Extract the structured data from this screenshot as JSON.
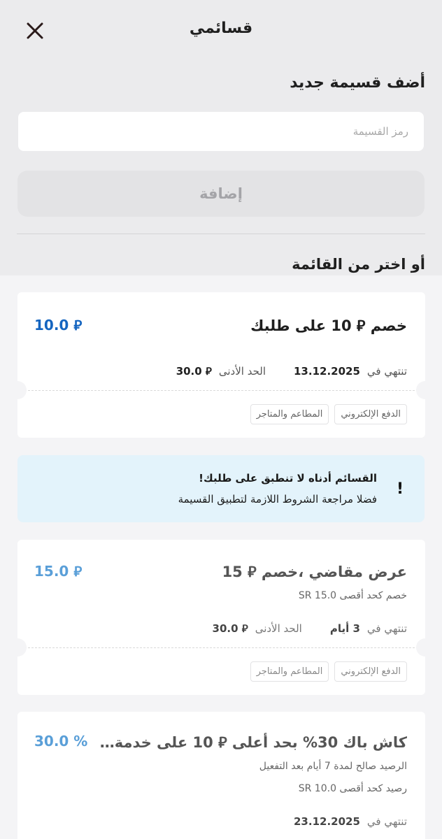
{
  "header": {
    "title": "قسائمي"
  },
  "add_section": {
    "heading": "أضف قسيمة جديد",
    "input_placeholder": "رمز القسيمة",
    "input_value": "",
    "button_label": "إضافة"
  },
  "list_heading": "أو اختر من القائمة",
  "colors": {
    "accent_blue": "#1565c0",
    "muted_blue": "#5a9fd8",
    "notice_bg": "#e3f3fb"
  },
  "coupons": [
    {
      "title": "خصم ⃁ 10 على طلبك",
      "value": "⃁ 10.0",
      "expires_label": "تنتهي في",
      "expires_value": "13.12.2025",
      "min_label": "الحد الأدنى",
      "min_value": "⃁ 30.0",
      "tags": [
        "الدفع الإلكتروني",
        "المطاعم والمتاجر"
      ]
    },
    {
      "title": "عرض مقاضي ،خصم ⃁ 15",
      "value": "⃁ 15.0",
      "subtitle": "خصم كحد أقصى SR 15.0",
      "expires_label": "تنتهي في",
      "expires_value": "3 أيام",
      "min_label": "الحد الأدنى",
      "min_value": "⃁ 30.0",
      "tags": [
        "الدفع الإلكتروني",
        "المطاعم والمتاجر"
      ]
    },
    {
      "title": "كاش باك 30% بحد أعلى ⃁ 10 على خدمة ا...",
      "value": "30.0 %",
      "subtitle_1": "الرصيد صالح لمدة 7 أيام بعد التفعيل",
      "subtitle_2": "رصيد كحد أقصى SR 10.0",
      "expires_label": "تنتهي في",
      "expires_value": "23.12.2025"
    }
  ],
  "notice": {
    "icon": "exclamation-icon",
    "title": "القسائم أدناه لا تنطبق على طلبك!",
    "body": "فضلا مراجعة الشروط اللازمة لتطبيق القسيمة"
  }
}
